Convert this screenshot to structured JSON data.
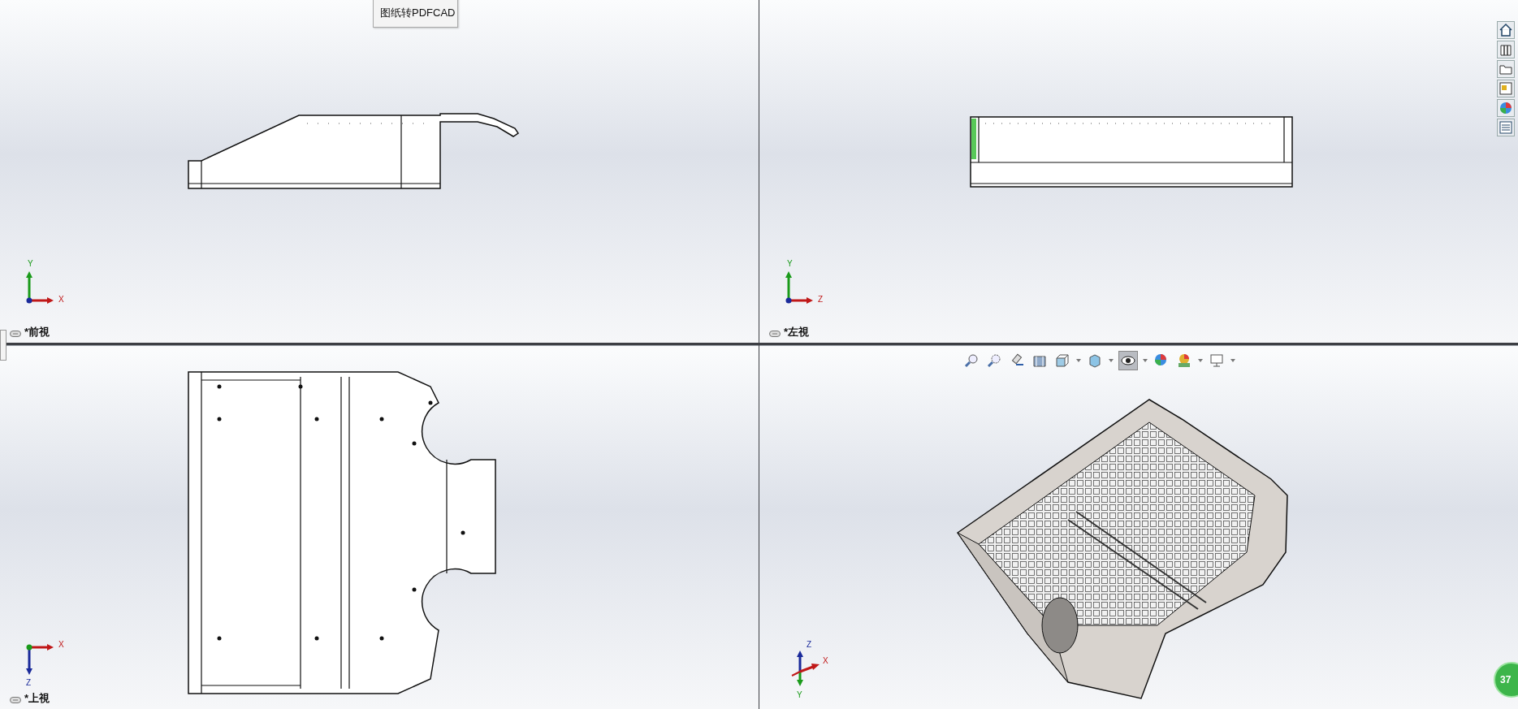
{
  "menu": {
    "items": [
      "图纸转PDFCAD"
    ]
  },
  "viewports": [
    {
      "kind": "front",
      "label": "*前視",
      "triad": {
        "kind": "up-right",
        "labels": [
          "Y",
          "X"
        ]
      }
    },
    {
      "kind": "left",
      "label": "*左視",
      "triad": {
        "kind": "up-right",
        "labels": [
          "Y",
          "Z"
        ]
      }
    },
    {
      "kind": "top",
      "label": "*上視",
      "triad": {
        "kind": "right-down",
        "labels": [
          "X",
          "Z"
        ]
      }
    },
    {
      "kind": "iso",
      "triad": {
        "kind": "iso",
        "labels": [
          "Z",
          "Y",
          "X"
        ]
      }
    }
  ],
  "badge": "37"
}
